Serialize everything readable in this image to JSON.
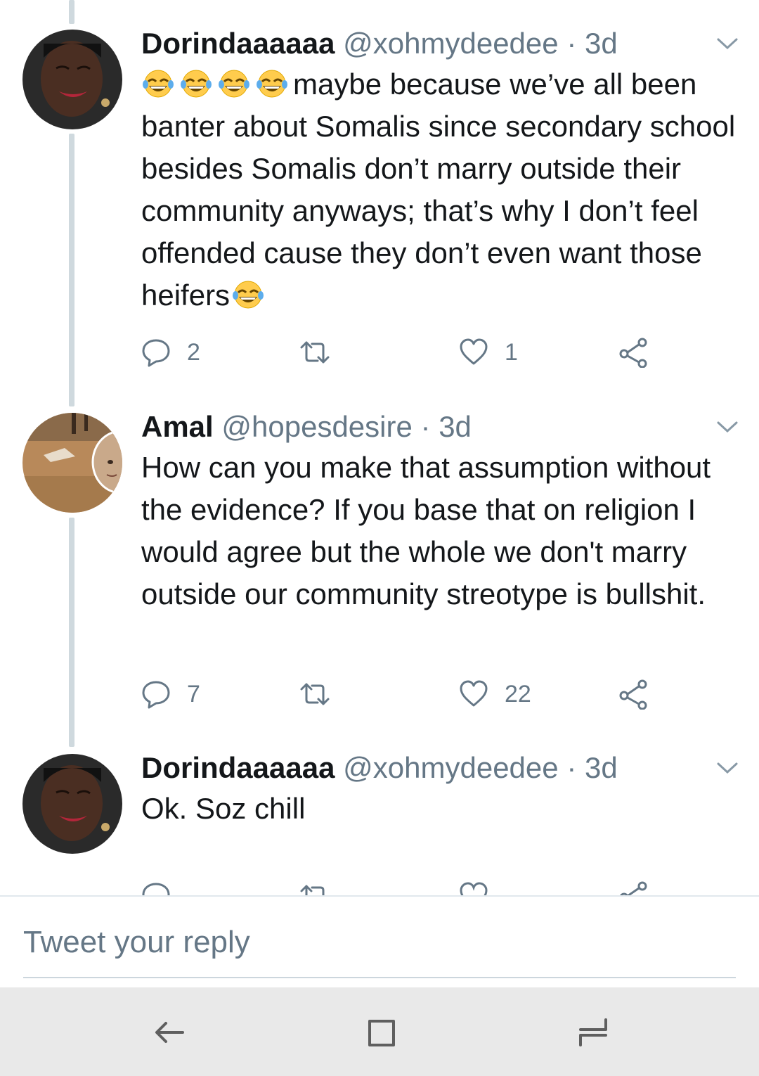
{
  "tweets": [
    {
      "name": "Dorindaaaaaa",
      "handle": "@xohmydeedee",
      "dot": "·",
      "time": "3d",
      "emoji_prefix": [
        "face-with-tears-of-joy",
        "face-with-tears-of-joy",
        "face-with-tears-of-joy",
        "face-with-tears-of-joy"
      ],
      "text": "maybe because we’ve all been banter about Somalis since secondary school besides Somalis don’t marry outside their community anyways; that’s why I don’t feel offended cause they don’t even want those heifers",
      "emoji_suffix": "face-with-tears-of-joy",
      "replies": "2",
      "retweets": "",
      "likes": "1"
    },
    {
      "name": "Amal",
      "handle": "@hopesdesire",
      "dot": "·",
      "time": "3d",
      "text": "How can you make that assumption without the evidence? If you base that on religion I would agree but the whole we don't marry outside our community streotype is bullshit.",
      "replies": "7",
      "retweets": "",
      "likes": "22"
    },
    {
      "name": "Dorindaaaaaa",
      "handle": "@xohmydeedee",
      "dot": "·",
      "time": "3d",
      "text": "Ok. Soz chill"
    }
  ],
  "reply_bar": {
    "placeholder": "Tweet your reply"
  },
  "colors": {
    "text": "#14171a",
    "secondary": "#657786",
    "thread_line": "#cfd9de",
    "navbar": "#e9e9e9"
  },
  "icons": [
    "reply-icon",
    "retweet-icon",
    "like-icon",
    "share-icon",
    "chevron-down-icon",
    "back-icon",
    "home-icon",
    "recents-icon"
  ]
}
